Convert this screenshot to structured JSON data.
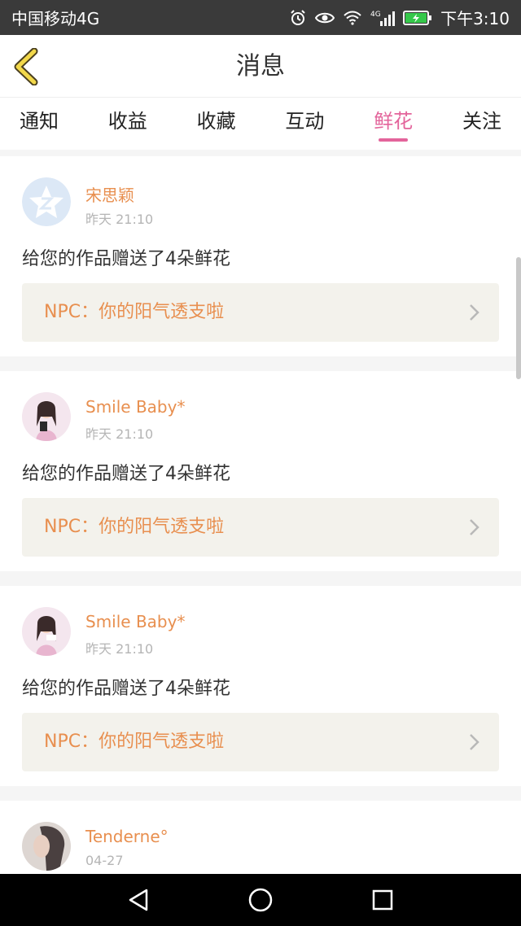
{
  "status_bar": {
    "carrier": "中国移动4G",
    "network_tag": "4G",
    "time": "下午3:10"
  },
  "header": {
    "title": "消息"
  },
  "tabs": [
    {
      "label": "通知",
      "active": false
    },
    {
      "label": "收益",
      "active": false
    },
    {
      "label": "收藏",
      "active": false
    },
    {
      "label": "互动",
      "active": false
    },
    {
      "label": "鲜花",
      "active": true
    },
    {
      "label": "关注",
      "active": false
    }
  ],
  "feed": [
    {
      "username": "宋思颖",
      "time": "昨天 21:10",
      "message": "给您的作品赠送了4朵鲜花",
      "npc_text": "NPC：你的阳气透支啦",
      "avatar": "default-avatar"
    },
    {
      "username": "Smile Baby*",
      "time": "昨天 21:10",
      "message": "给您的作品赠送了4朵鲜花",
      "npc_text": "NPC：你的阳气透支啦",
      "avatar": "photo-avatar"
    },
    {
      "username": "Smile Baby*",
      "time": "昨天 21:10",
      "message": "给您的作品赠送了4朵鲜花",
      "npc_text": "NPC：你的阳气透支啦",
      "avatar": "photo-avatar"
    },
    {
      "username": "Tenderne°",
      "time": "04-27",
      "avatar": "photo-avatar"
    }
  ],
  "colors": {
    "accent_pink": "#e3649b",
    "name_orange": "#e88f4f",
    "npc_bg": "#f3f2ec",
    "status_bar_bg": "#3a3a3a"
  }
}
